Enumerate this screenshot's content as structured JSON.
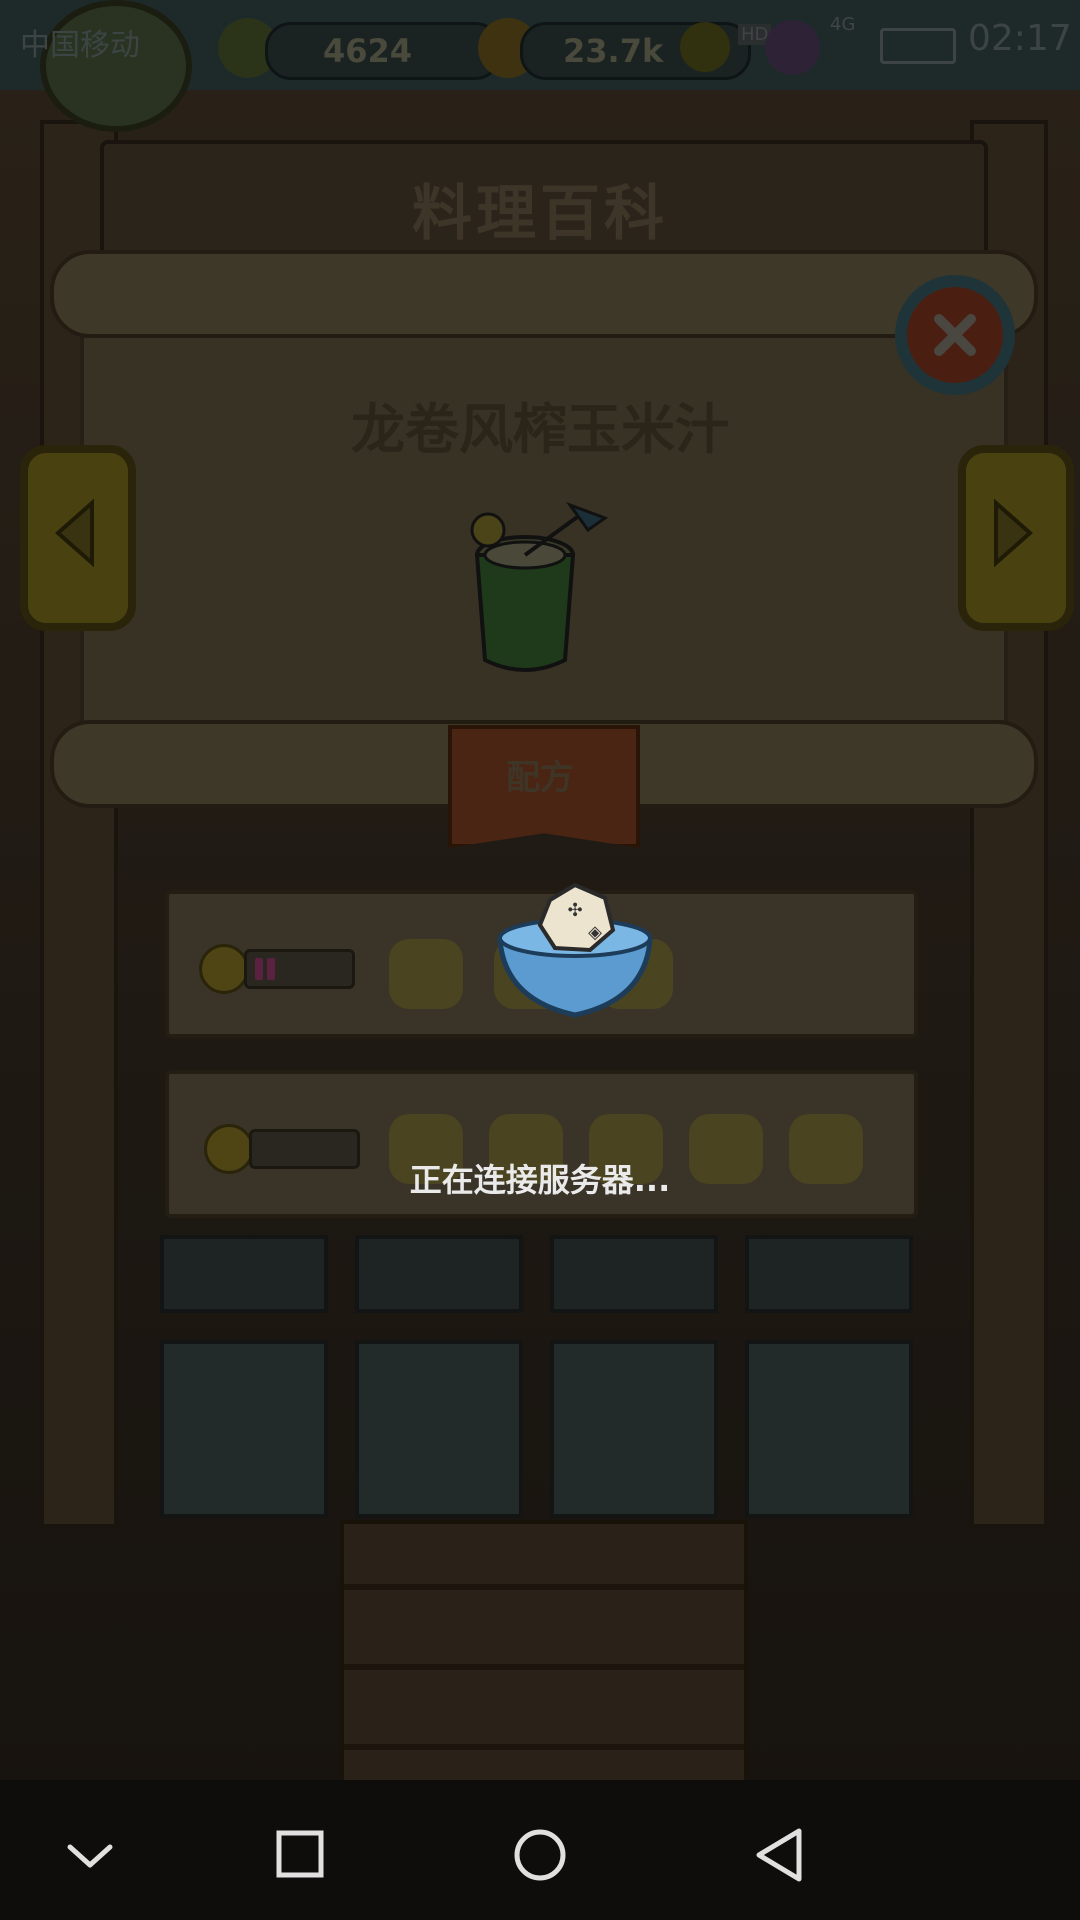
{
  "status_bar": {
    "carrier": "中国移动",
    "gems": "4624",
    "coins": "23.7k",
    "signal_badge": "HD",
    "network": "4G",
    "time": "02:17"
  },
  "page_title": "料理百科",
  "dish_name": "龙卷风榨玉米汁",
  "recipe_tab_label": "配方",
  "recipe_rows": [
    {
      "mood": "happy",
      "progress": 0.2,
      "corn_count": 3
    },
    {
      "mood": "sad",
      "progress": 0.0,
      "corn_count": 5
    }
  ],
  "loading_text": "正在连接服务器...",
  "icons": {
    "close": "close-icon",
    "prev": "arrow-left-icon",
    "next": "arrow-right-icon",
    "nav_down": "chevron-down-icon",
    "nav_recent": "square-icon",
    "nav_home": "circle-icon",
    "nav_back": "triangle-back-icon"
  },
  "colors": {
    "overlay_text": "#eaeaea",
    "progress_fill": "#5b2140"
  }
}
